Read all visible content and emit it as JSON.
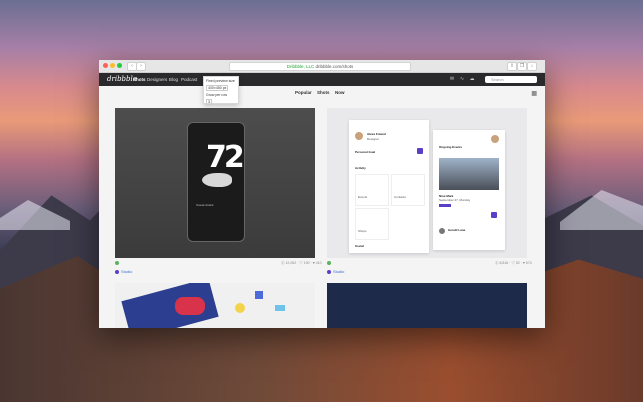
{
  "browser": {
    "address": "dribbble.com/shots",
    "address_secure": "Dribbble, LLC",
    "tab_back": "‹",
    "tab_forward": "›"
  },
  "navbar": {
    "logo": "dribbble",
    "items": [
      "Shots",
      "Designers",
      "Blog",
      "Podcast"
    ],
    "search_placeholder": "Search"
  },
  "tooltip": {
    "line1": "Fixed preview size",
    "size": "400×450 px",
    "line2": "Grow per row",
    "count": "3"
  },
  "filters": {
    "sort": "Popular",
    "type": "Shots",
    "time": "Now"
  },
  "shots": [
    {
      "number": "72",
      "card_text": "Sneak Attack",
      "meta": "Ⓒ 12,052 · ♡ 190 · ♥ 410",
      "author": "Studio"
    },
    {
      "profile_name": "Alexa Foland",
      "profile_role": "Designer",
      "section1": "Personal Goal",
      "section2": "Activity",
      "tiles": [
        "Events",
        "Contacts",
        "Shops"
      ],
      "event_title": "Ongoing Events",
      "event_name": "Nine Mark",
      "event_date": "September 27, Monday",
      "section3": "Social",
      "guest": "Gerald Lane",
      "meta": "Ⓒ 8,816 · ♡ 52 · ♥ 574",
      "author": "Studio"
    }
  ],
  "colors": {
    "accent": "#5b3ec8",
    "link": "#3a6ed3",
    "navbar": "#2a2a2d"
  }
}
